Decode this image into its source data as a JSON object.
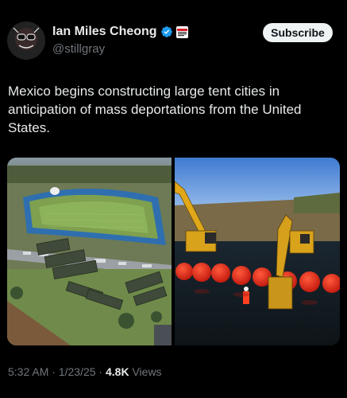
{
  "author": {
    "name": "Ian Miles Cheong",
    "handle": "@stillgray"
  },
  "subscribe_label": "Subscribe",
  "tweet": {
    "text": "Mexico begins constructing large tent cities in anticipation of mass deportations from the United States."
  },
  "meta": {
    "time": "5:32 AM",
    "separator1": " · ",
    "date": "1/23/25",
    "separator2": " · ",
    "views_count": "4.8K",
    "views_label": " Views"
  },
  "colors": {
    "background": "#000000",
    "text": "#e7e9ea",
    "muted": "#71767b",
    "verified": "#1d9bf0",
    "button_bg": "#eff3f4"
  },
  "icons": {
    "verified": "verified-badge-icon",
    "affiliation": "affiliate-badge-icon"
  }
}
